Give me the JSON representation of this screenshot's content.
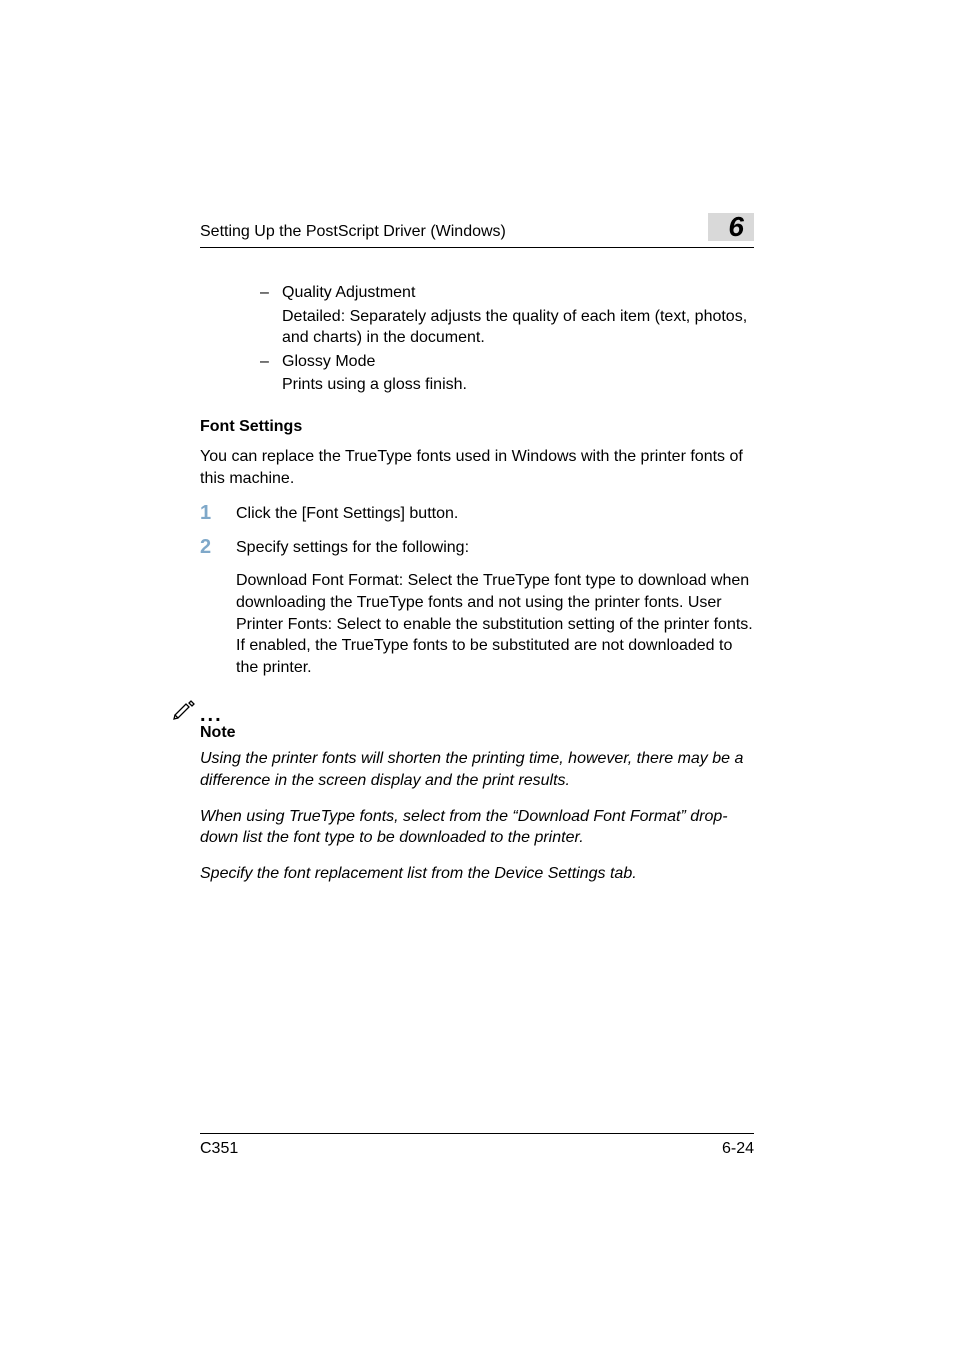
{
  "header": {
    "title": "Setting Up the PostScript Driver (Windows)",
    "chapter_number": "6"
  },
  "bullets": {
    "item1_title": "Quality Adjustment",
    "item1_detail": "Detailed: Separately adjusts the quality of each item (text, photos, and charts) in the document.",
    "item2_title": "Glossy Mode",
    "item2_detail": "Prints using a gloss finish."
  },
  "section_heading": "Font Settings",
  "intro_para": "You can replace the TrueType fonts used in Windows with the printer fonts of this machine.",
  "steps": {
    "s1_text": "Click the [Font Settings] button.",
    "s2_text": "Specify settings for the following:",
    "s2_detail": "Download Font Format: Select the TrueType font type to download when downloading the TrueType fonts and not using the printer fonts. User Printer Fonts: Select to enable the substitution setting of the printer fonts. If enabled, the TrueType fonts to be substituted are not downloaded to the printer."
  },
  "note": {
    "label": "Note",
    "p1": "Using the printer fonts will shorten the printing time, however, there may be a difference in the screen display and the print results.",
    "p2": "When using TrueType fonts, select from the “Download Font Format” drop-down list the font type to be downloaded to the printer.",
    "p3": "Specify the font replacement list from the Device Settings tab."
  },
  "footer": {
    "model": "C351",
    "page_number": "6-24"
  }
}
